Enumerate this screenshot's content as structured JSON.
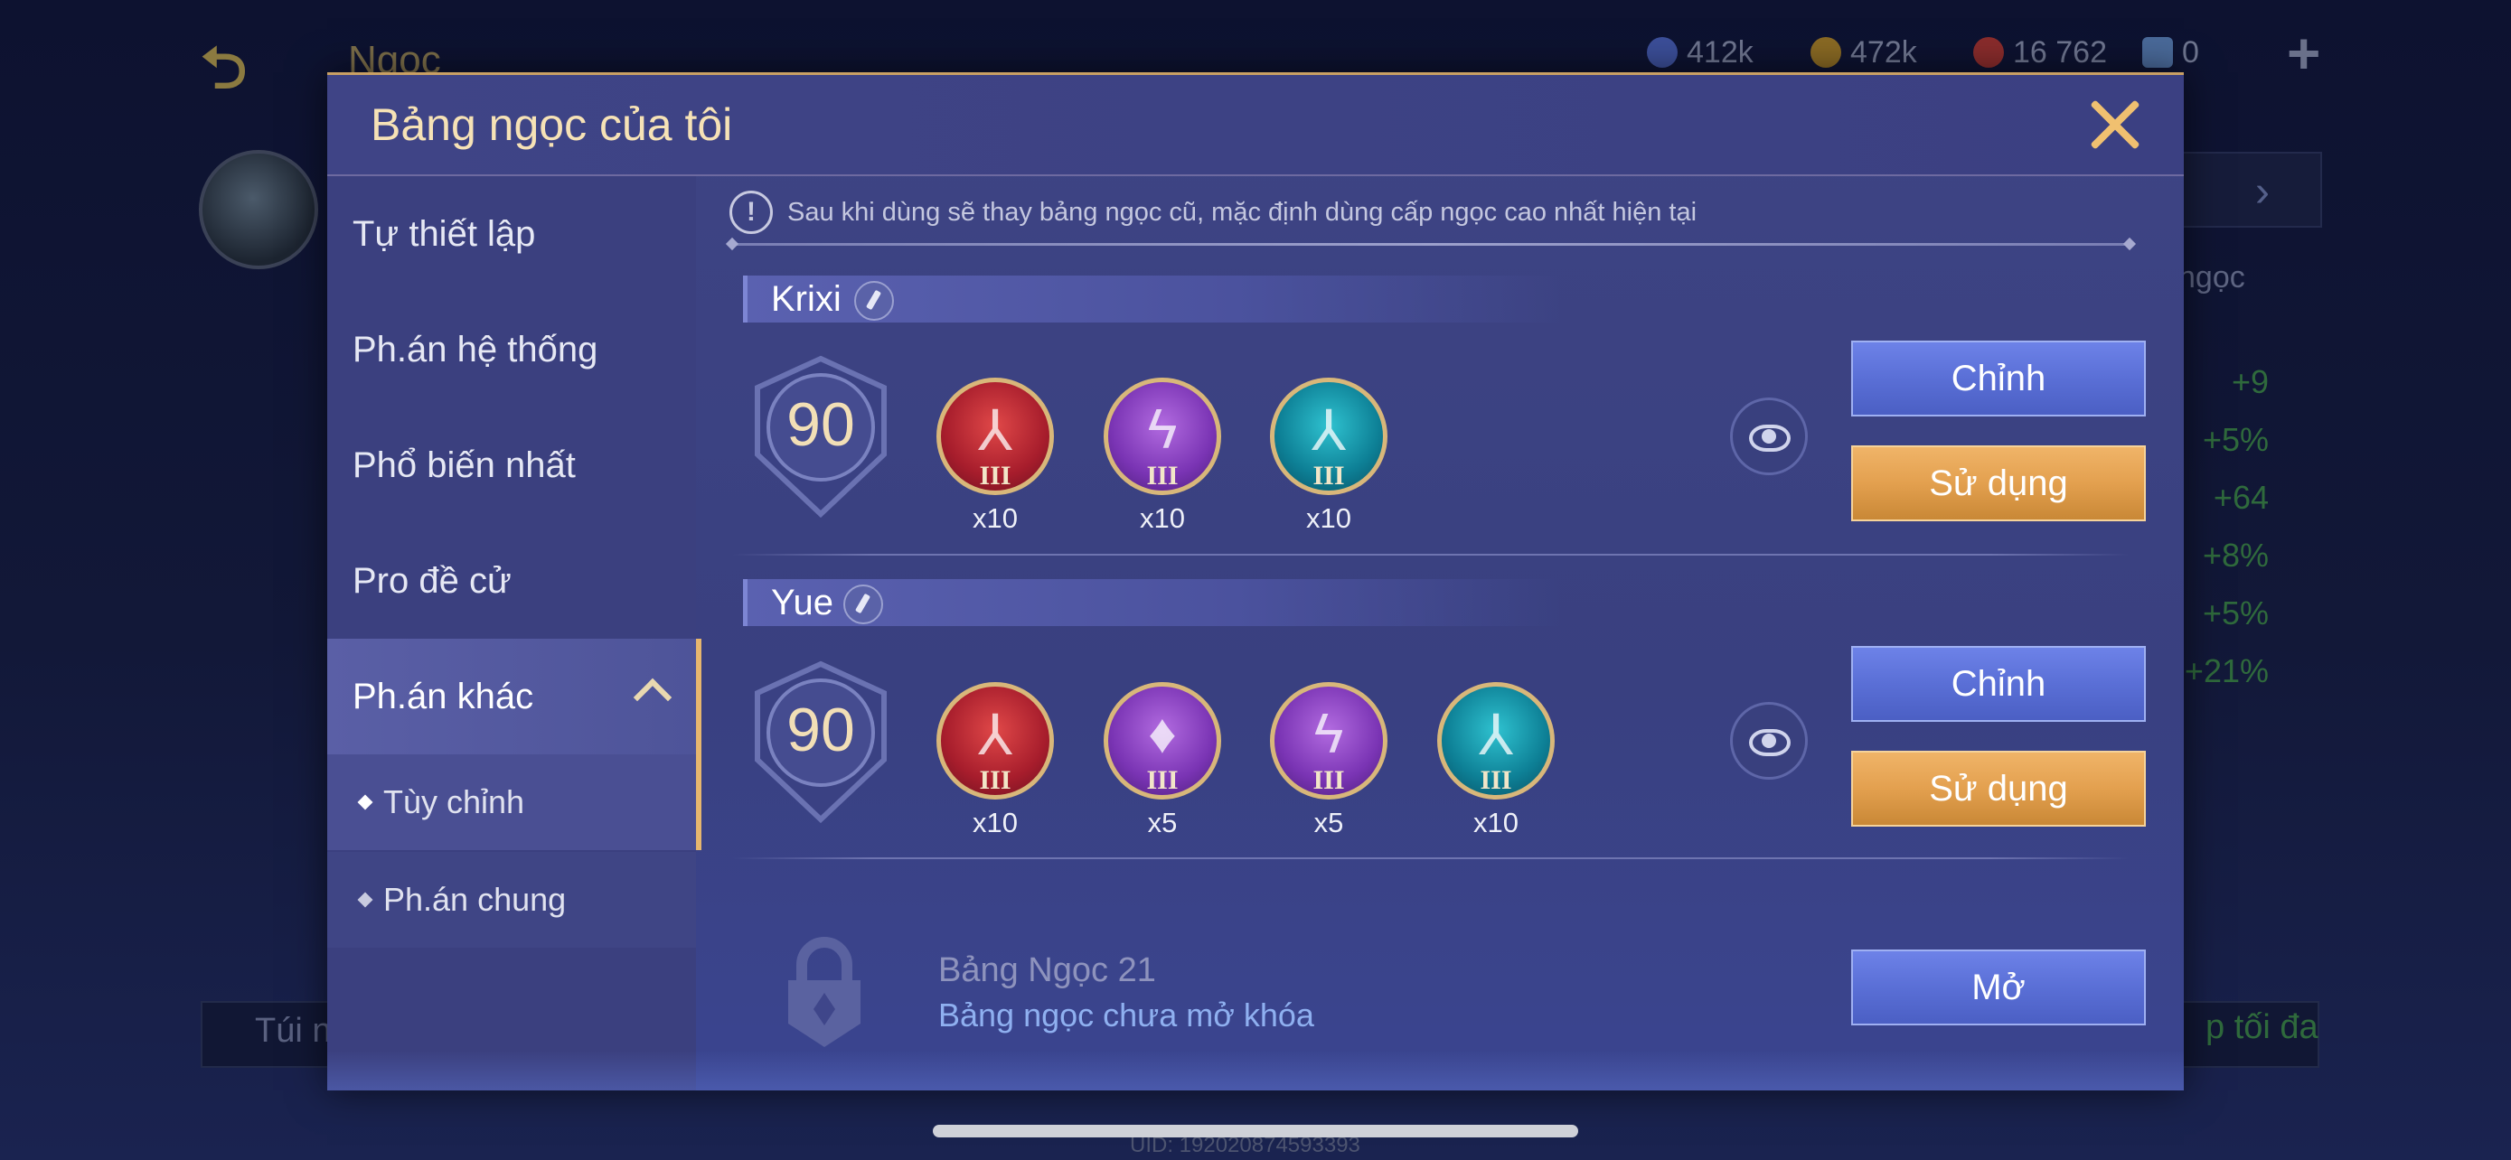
{
  "background": {
    "title": "Ngọc",
    "resources": [
      {
        "icon": "blue-gem-icon",
        "value": "412k",
        "color": "#3c4f9a"
      },
      {
        "icon": "gold-coin-icon",
        "value": "472k",
        "color": "#8a6a24"
      },
      {
        "icon": "red-gem-icon",
        "value": "16 762",
        "color": "#8a2c2c"
      },
      {
        "icon": "ticket-icon",
        "value": "0",
        "color": "#4a6a9a"
      }
    ],
    "side_label": "ngọc",
    "stats": [
      "+9",
      "+5%",
      "+64",
      "+8%",
      "+5%",
      "+21%"
    ],
    "bottom_left": "Túi n",
    "bottom_right": "p tối đa",
    "uid": "UID: 192020874593393"
  },
  "modal": {
    "title": "Bảng ngọc của tôi",
    "sidebar": {
      "items": [
        {
          "label": "Tự thiết lập"
        },
        {
          "label": "Ph.án hệ thống"
        },
        {
          "label": "Phổ biến nhất"
        },
        {
          "label": "Pro đề cử"
        },
        {
          "label": "Ph.án khác"
        }
      ],
      "sub_items": [
        {
          "label": "Tùy chỉnh"
        },
        {
          "label": "Ph.án chung"
        }
      ]
    },
    "notice": "Sau khi dùng sẽ thay bảng ngọc cũ, mặc định dùng cấp ngọc cao nhất hiện tại",
    "sets": [
      {
        "name": "Krixi",
        "level": "90",
        "gems": [
          {
            "color": "red",
            "icon": "red-rune-icon",
            "tier": "III",
            "count": "x10"
          },
          {
            "color": "purple",
            "icon": "purple-lightning-rune-icon",
            "tier": "III",
            "count": "x10"
          },
          {
            "color": "teal",
            "icon": "teal-rune-icon",
            "tier": "III",
            "count": "x10"
          }
        ],
        "edit_label": "Chỉnh",
        "use_label": "Sử dụng"
      },
      {
        "name": "Yue",
        "level": "90",
        "gems": [
          {
            "color": "red",
            "icon": "red-rune-icon",
            "tier": "III",
            "count": "x10"
          },
          {
            "color": "purple",
            "icon": "purple-drop-rune-icon",
            "tier": "III",
            "count": "x5"
          },
          {
            "color": "purple",
            "icon": "purple-lightning-rune-icon",
            "tier": "III",
            "count": "x5"
          },
          {
            "color": "teal",
            "icon": "teal-rune-icon",
            "tier": "III",
            "count": "x10"
          }
        ],
        "edit_label": "Chỉnh",
        "use_label": "Sử dụng"
      }
    ],
    "locked": {
      "title": "Bảng Ngọc 21",
      "subtitle": "Bảng ngọc chưa mở khóa",
      "button": "Mở"
    }
  }
}
